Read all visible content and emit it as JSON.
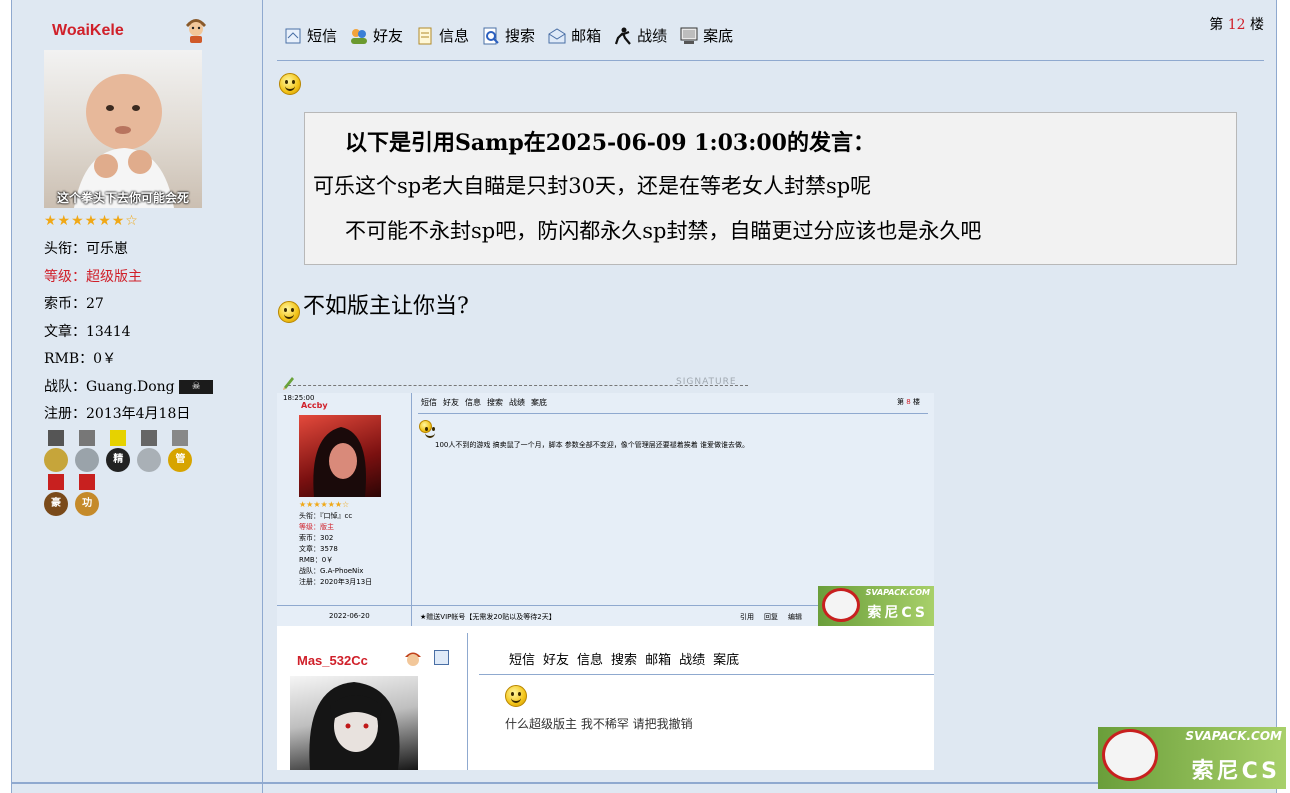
{
  "user": {
    "name": "WoaiKele",
    "avatar_caption": "这个拳头下去你可能会死",
    "stars": "★★★★★★☆",
    "info": [
      {
        "label": "头衔：",
        "value": "可乐崽"
      },
      {
        "label": "等级：",
        "value": "超级版主"
      },
      {
        "label": "索币：",
        "value": "27"
      },
      {
        "label": "文章：",
        "value": "13414"
      },
      {
        "label": "RMB：",
        "value": "0￥"
      },
      {
        "label": "战队：",
        "value": "Guang.Dong"
      },
      {
        "label": "注册：",
        "value": "2013年4月18日"
      }
    ],
    "medal_texts": [
      "",
      "",
      "精",
      "",
      "管",
      "豪",
      "功"
    ]
  },
  "toolbar": {
    "items": [
      "短信",
      "好友",
      "信息",
      "搜索",
      "邮箱",
      "战绩",
      "案底"
    ]
  },
  "floor": {
    "prefix": "第",
    "number": "12",
    "suffix": "楼"
  },
  "quote": {
    "header": "以下是引用Samp在2025-06-09 1:03:00的发言：",
    "line1": "可乐这个sp老大自瞄是只封30天，还是在等老女人封禁sp呢",
    "line2": "不可能不永封sp吧，防闪都永久sp封禁，自瞄更过分应该也是永久吧"
  },
  "reply_text": "不如版主让你当?",
  "signature_label": "SIGNATURE",
  "embedded_post_1": {
    "time": "18:25:00",
    "user": "Accby",
    "stars": "★★★★★★☆",
    "info": [
      "头衔：『口悼』cc",
      "等级：版主",
      "索币：302",
      "文章：3578",
      "RMB：0￥",
      "战队：G.A-PhoeNix",
      "注册：2020年3月13日"
    ],
    "toolbar": [
      "短信",
      "好友",
      "信息",
      "搜索",
      "战绩",
      "案底"
    ],
    "floor": {
      "prefix": "第",
      "number": "8",
      "suffix": "楼"
    },
    "text": "100人不到的游戏 搞卖鼠了一个月，脚本 参数全部不变迎，像个管理层还要褪着挨着 谁爱做谁去做。",
    "date": "2022-06-20",
    "vip": "★赠送VIP帐号【无需发20贴以及等待2天】",
    "actions": [
      "引用",
      "回复",
      "编辑"
    ]
  },
  "embedded_post_2": {
    "user": "Mas_532Cc",
    "toolbar": [
      "短信",
      "好友",
      "信息",
      "搜索",
      "邮箱",
      "战绩",
      "案底"
    ],
    "text": "什么超级版主 我不稀罕 请把我撤销"
  },
  "logo": {
    "text": "SVAPACK.COM",
    "cn_text": "索尼CS"
  },
  "colors": {
    "background": "#dfe8f2",
    "border": "#8fa9cf",
    "accent_red": "#d0202a",
    "quote_bg": "#f2f2f2"
  }
}
